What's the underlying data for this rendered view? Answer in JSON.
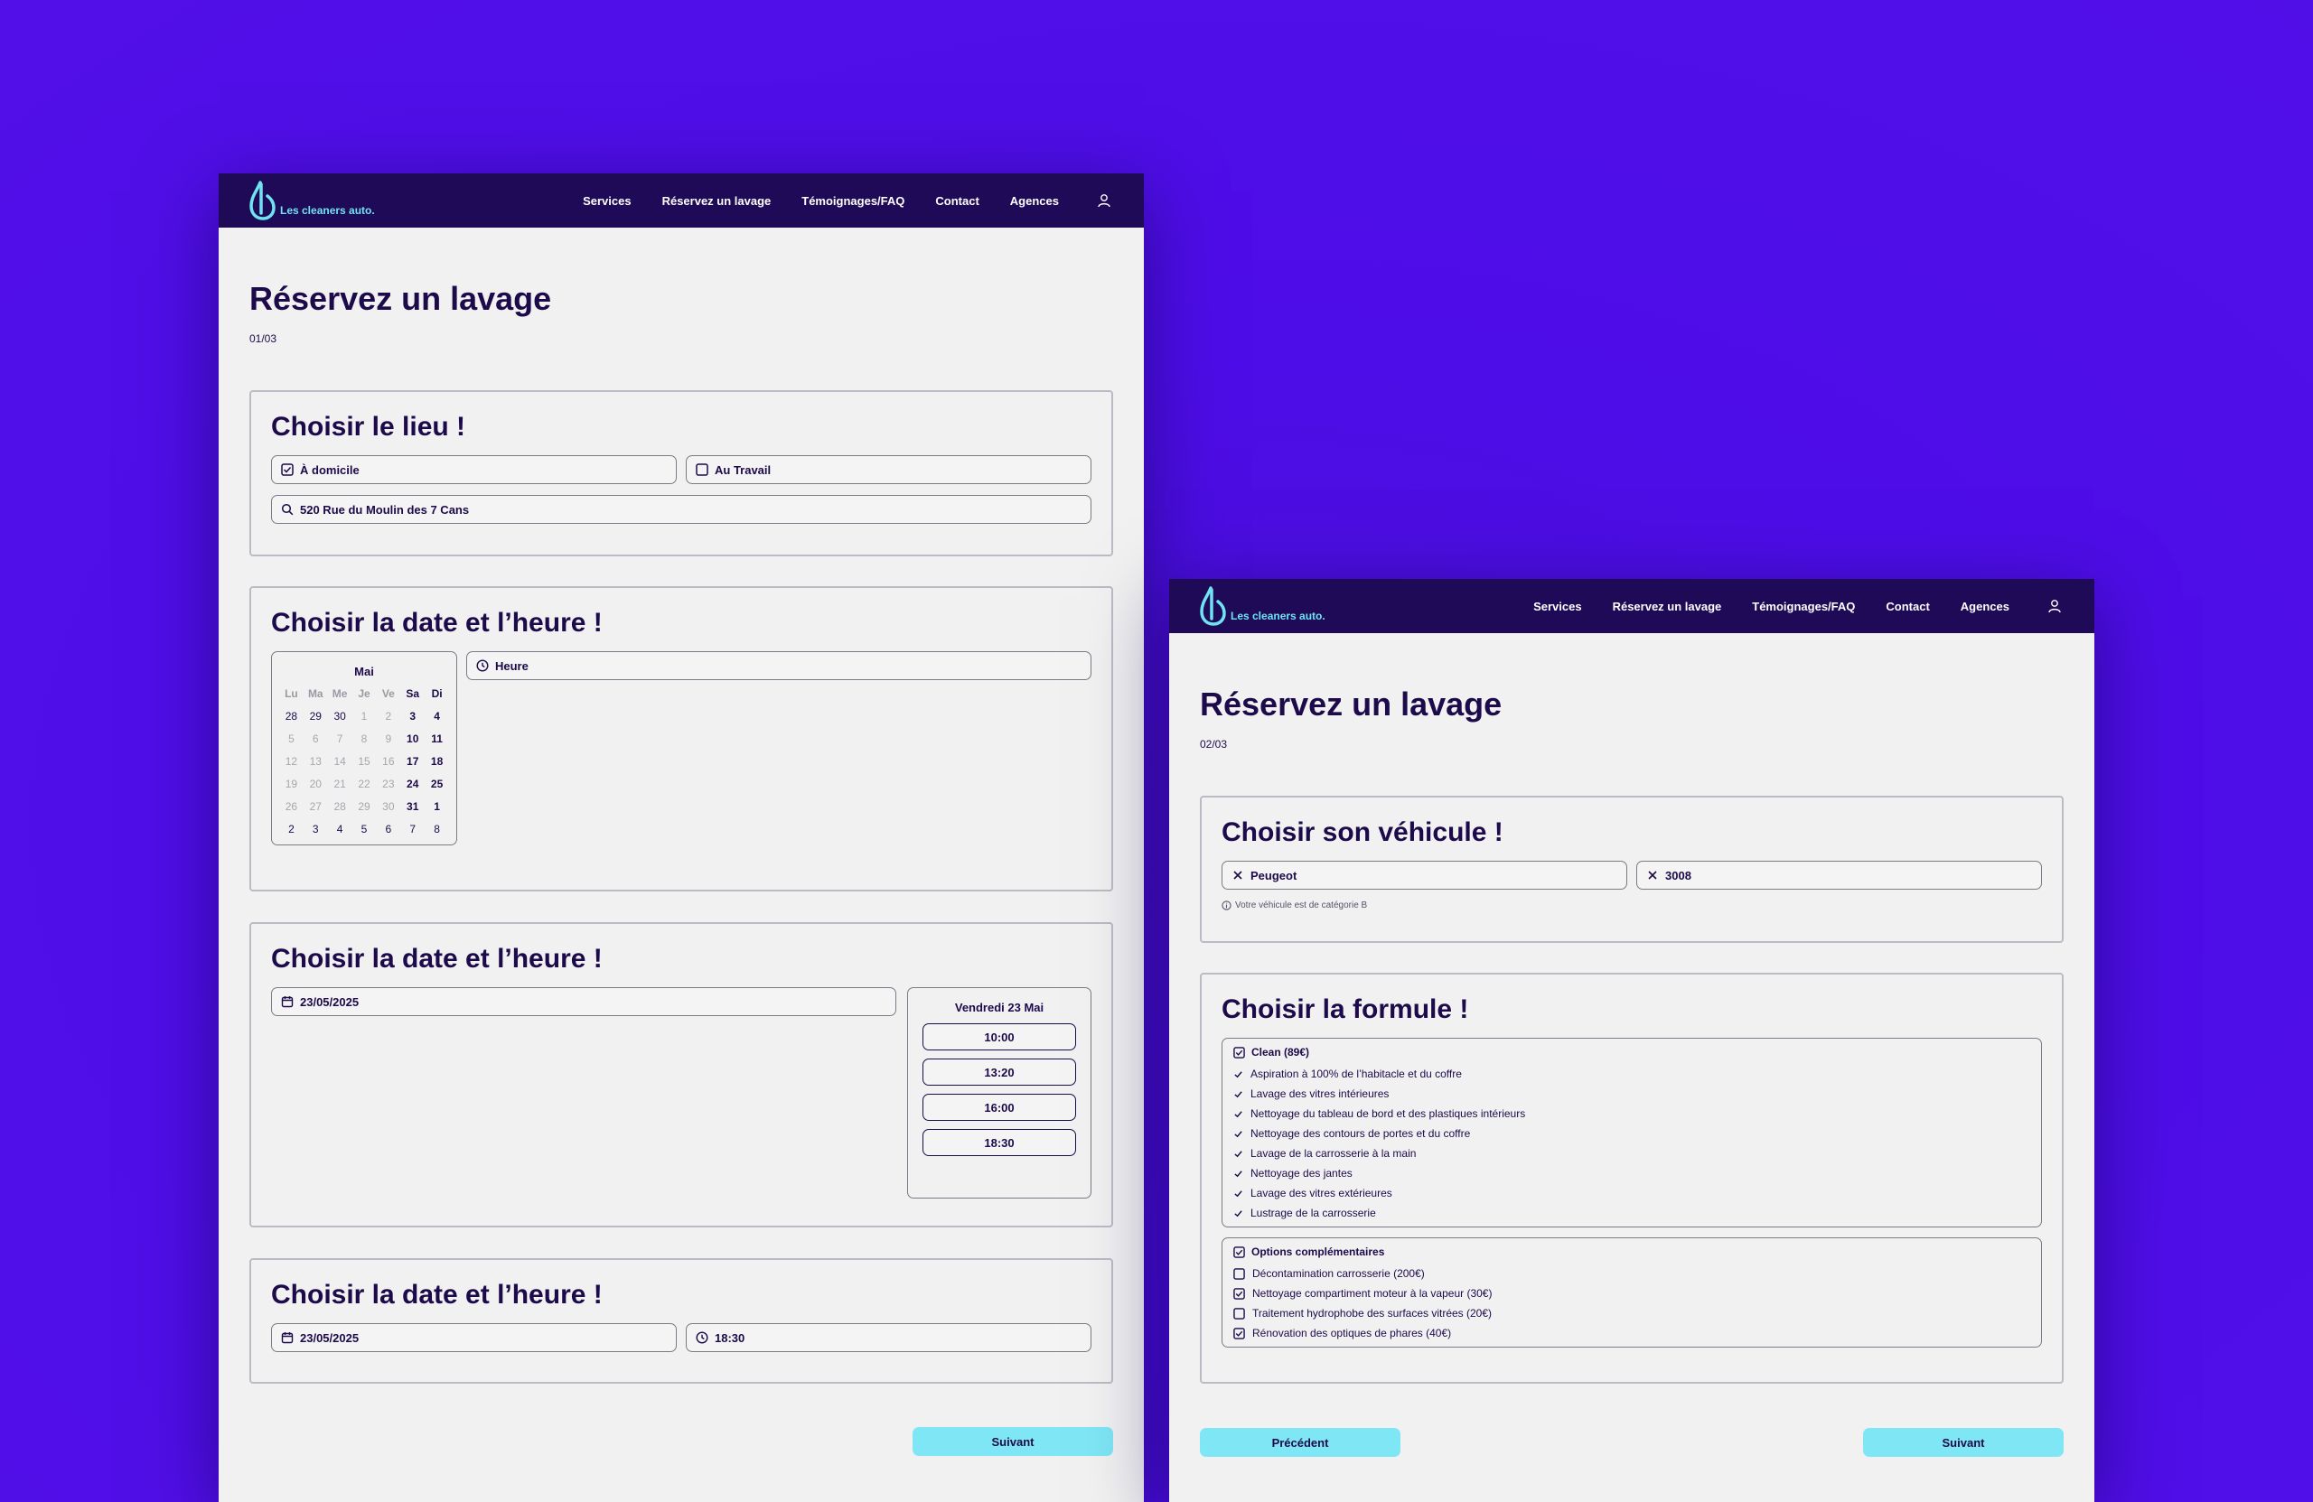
{
  "nav": {
    "brand": "Les cleaners auto.",
    "links": [
      "Services",
      "Réservez un lavage",
      "Témoignages/FAQ",
      "Contact",
      "Agences"
    ]
  },
  "screen1": {
    "title": "Réservez un lavage",
    "step": "01/03",
    "lieu": {
      "title": "Choisir le lieu !",
      "option_home": "À domicile",
      "option_work": "Au Travail",
      "address": "520 Rue du Moulin des 7 Cans"
    },
    "datetime1": {
      "title": "Choisir la date et l’heure !",
      "hour_placeholder": "Heure",
      "calendar": {
        "month": "Mai",
        "weekdays": [
          "Lu",
          "Ma",
          "Me",
          "Je",
          "Ve",
          "Sa",
          "Di"
        ],
        "weeks": [
          [
            "28",
            "29",
            "30",
            "1",
            "2",
            "3",
            "4"
          ],
          [
            "5",
            "6",
            "7",
            "8",
            "9",
            "10",
            "11"
          ],
          [
            "12",
            "13",
            "14",
            "15",
            "16",
            "17",
            "18"
          ],
          [
            "19",
            "20",
            "21",
            "22",
            "23",
            "24",
            "25"
          ],
          [
            "26",
            "27",
            "28",
            "29",
            "30",
            "31",
            "1"
          ],
          [
            "2",
            "3",
            "4",
            "5",
            "6",
            "7",
            "8"
          ]
        ]
      }
    },
    "datetime2": {
      "title": "Choisir la date et l’heure !",
      "date": "23/05/2025",
      "day_label": "Vendredi 23 Mai",
      "slots": [
        "10:00",
        "13:20",
        "16:00",
        "18:30"
      ]
    },
    "datetime3": {
      "title": "Choisir la date et l’heure !",
      "date": "23/05/2025",
      "time": "18:30"
    },
    "next": "Suivant"
  },
  "screen2": {
    "title": "Réservez un lavage",
    "step": "02/03",
    "vehicle": {
      "title": "Choisir son véhicule !",
      "brand": "Peugeot",
      "model": "3008",
      "info": "Votre véhicule est de catégorie B"
    },
    "formule": {
      "title": "Choisir la formule !",
      "plan": "Clean (89€)",
      "features": [
        "Aspiration à 100% de l’habitacle et du coffre",
        "Lavage des vitres intérieures",
        "Nettoyage du tableau de bord et des plastiques intérieurs",
        "Nettoyage des contours de portes et du coffre",
        "Lavage  de la carrosserie à la main",
        "Nettoyage des jantes",
        "Lavage des vitres extérieures",
        "Lustrage de la carrosserie"
      ],
      "options_title": "Options complémentaires",
      "options": [
        {
          "label": "Décontamination carrosserie (200€)",
          "checked": false
        },
        {
          "label": "Nettoyage compartiment moteur à la vapeur (30€)",
          "checked": true
        },
        {
          "label": "Traitement hydrophobe des surfaces vitrées (20€)",
          "checked": false
        },
        {
          "label": "Rénovation des optiques de phares (40€)",
          "checked": true
        }
      ]
    },
    "prev": "Précédent",
    "next": "Suivant"
  },
  "colors": {
    "background": "#4f0ce6",
    "nav": "#1f0a57",
    "accent": "#7ee6f4",
    "text": "#1c0a4a"
  }
}
